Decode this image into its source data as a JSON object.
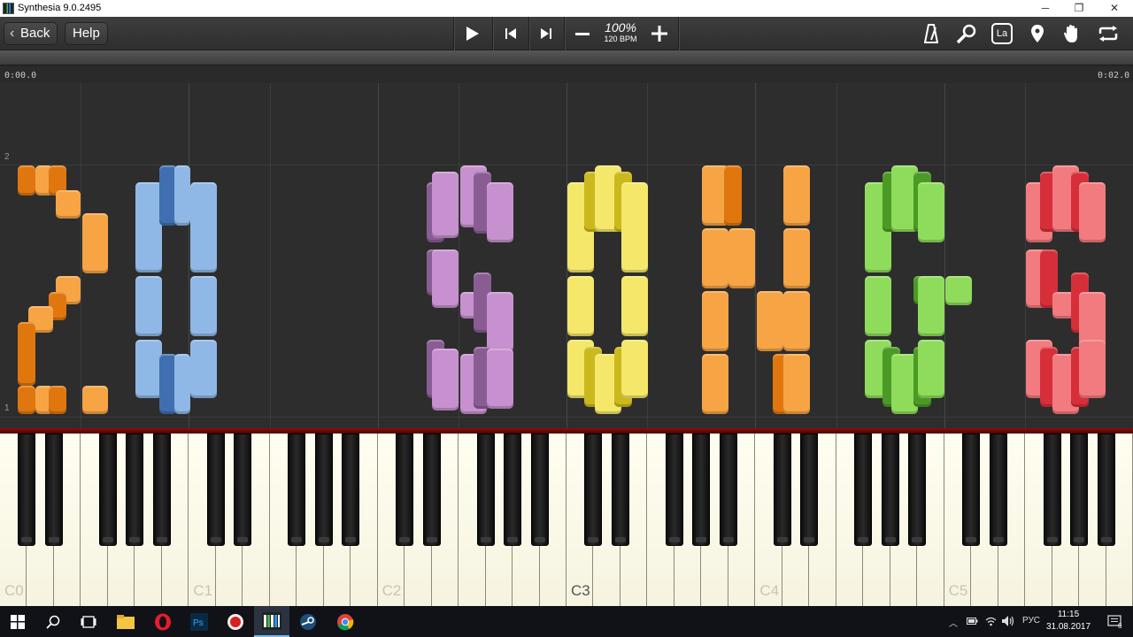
{
  "window": {
    "title": "Synthesia 9.0.2495",
    "minimize": "─",
    "maximize": "❐",
    "close": "✕"
  },
  "toolbar": {
    "back_label": "Back",
    "help_label": "Help",
    "tempo_percent": "100%",
    "tempo_bpm": "120 BPM",
    "settings_badge": "La"
  },
  "timeline": {
    "start": "0:00.0",
    "end": "0:02.0"
  },
  "field": {
    "measures": [
      "2",
      "1"
    ]
  },
  "keyboard": {
    "octave_labels": [
      "C0",
      "C1",
      "C2",
      "C3",
      "C4",
      "C5"
    ],
    "highlighted_label": "C3"
  },
  "taskbar": {
    "time": "11:15",
    "date": "31.08.2017",
    "language": "РУС",
    "notification_count": "6"
  },
  "colors": {
    "orange": "#f7a445",
    "orange_dark": "#e0770e",
    "blue": "#8fb8e6",
    "blue_dark": "#3f6fb0",
    "purple": "#c791cf",
    "purple_dark": "#8a5c94",
    "yellow": "#f4e76a",
    "yellow_dark": "#cbb81c",
    "green": "#8fdc5c",
    "green_dark": "#4a9a25",
    "red": "#f27b7f",
    "red_dark": "#d62f3a"
  }
}
